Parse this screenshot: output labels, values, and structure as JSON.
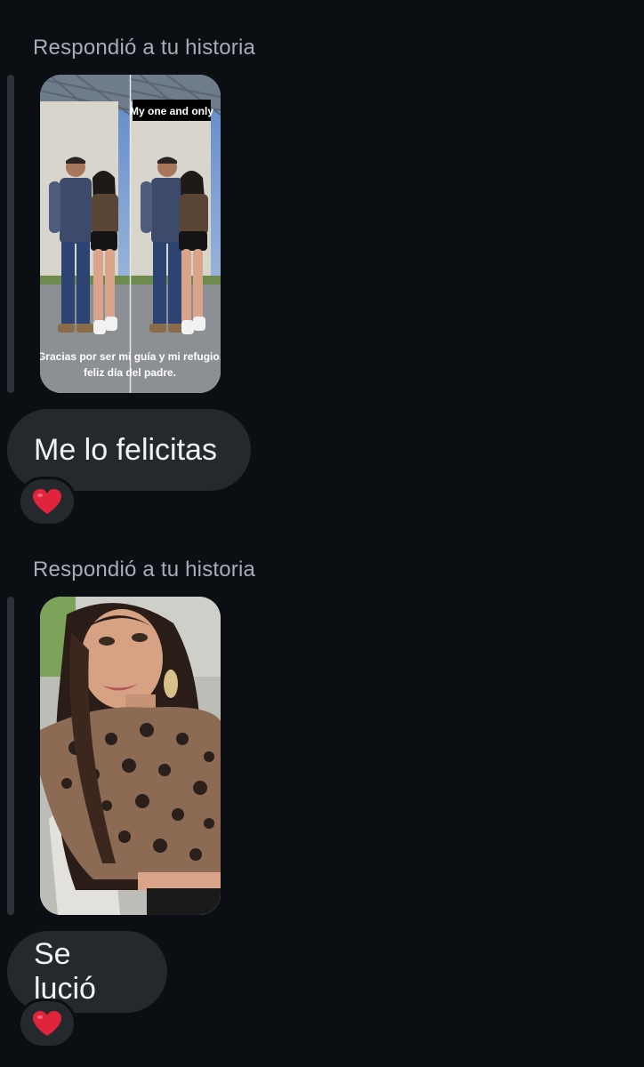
{
  "messages": [
    {
      "reply_label": "Respondió a tu historia",
      "story": {
        "overlay_tag": "My one and only",
        "caption_line1": "Gracias por ser mi guía y mi refugio,",
        "caption_line2": "feliz día del padre."
      },
      "text": "Me lo felicitas",
      "reaction": "heart-emoji"
    },
    {
      "reply_label": "Respondió a tu historia",
      "story": {},
      "text": "Se lució",
      "reaction": "heart-emoji"
    }
  ],
  "colors": {
    "background": "#0b0f14",
    "bubble": "#25282d",
    "label": "#a7adb6",
    "heart": "#e0243b"
  }
}
